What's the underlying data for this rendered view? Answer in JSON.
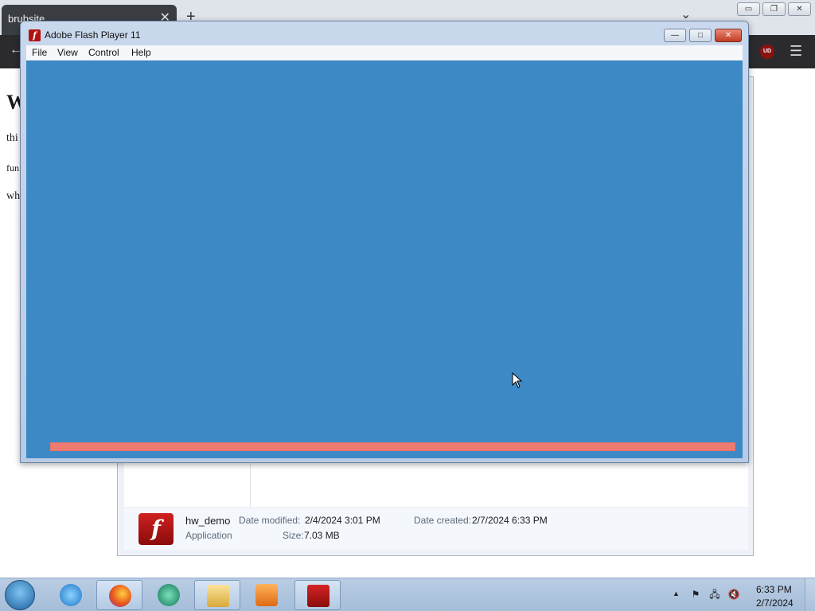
{
  "browser": {
    "tab_title": "brubsite",
    "tab_close": "✕",
    "new_tab": "+",
    "tab_list": "⌄",
    "minimize": "▭",
    "restore": "❐",
    "close": "✕",
    "back": "←",
    "ublock_badge": "UD",
    "menu": "☰"
  },
  "webpage": {
    "heading": "W",
    "line1": "thi",
    "line2": "fun",
    "line3": "wh"
  },
  "explorer": {
    "file_icon_glyph": "f",
    "file_name": "hw_demo",
    "file_type": "Application",
    "date_modified_label": "Date modified:",
    "date_modified_value": "2/4/2024 3:01 PM",
    "date_created_label": "Date created:",
    "date_created_value": "2/7/2024 6:33 PM",
    "size_label": "Size:",
    "size_value": "7.03 MB"
  },
  "flash": {
    "app_icon_glyph": "f",
    "title": "Adobe Flash Player 11",
    "minimize": "—",
    "restore": "□",
    "close": "✕",
    "menu": [
      "File",
      "View",
      "Control",
      "Help"
    ],
    "stage_color": "#3c89c6",
    "loading_progress": 1.0,
    "progress_color": "#ef7a70"
  },
  "taskbar": {
    "tray_arrow": "▲",
    "tray_flag": "⚑",
    "tray_network": "🖧",
    "tray_volume": "🔇",
    "time": "6:33 PM",
    "date": "2/7/2024"
  }
}
